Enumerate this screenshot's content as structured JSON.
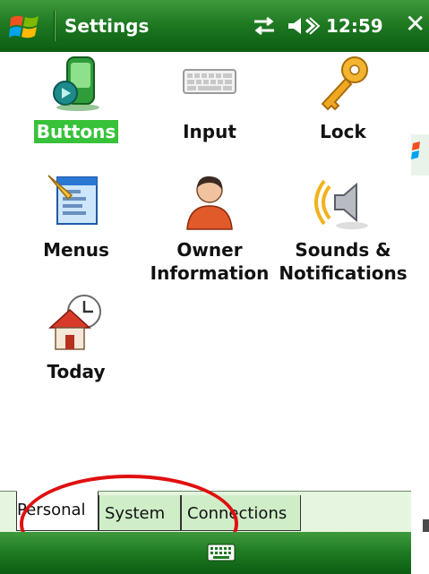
{
  "titlebar": {
    "title": "Settings",
    "clock": "12:59",
    "close": "✕",
    "icons": [
      "windows-start-icon",
      "connectivity-icon",
      "volume-icon"
    ]
  },
  "items": [
    {
      "label": "Buttons",
      "icon": "buttons-icon",
      "selected": true
    },
    {
      "label": "Input",
      "icon": "keyboard-icon",
      "selected": false
    },
    {
      "label": "Lock",
      "icon": "key-icon",
      "selected": false
    },
    {
      "label": "Menus",
      "icon": "menus-icon",
      "selected": false
    },
    {
      "label_line1": "Owner",
      "label_line2": "Information",
      "icon": "owner-icon",
      "selected": false
    },
    {
      "label_line1": "Sounds &",
      "label_line2": "Notifications",
      "icon": "sounds-icon",
      "selected": false
    },
    {
      "label": "Today",
      "icon": "today-icon",
      "selected": false
    }
  ],
  "tabs": [
    {
      "label": "Personal",
      "active": true
    },
    {
      "label": "System",
      "active": false
    },
    {
      "label": "Connections",
      "active": false
    }
  ],
  "bottombar": {
    "icon": "keyboard-toggle-icon"
  },
  "colors": {
    "titlebar_green": "#1f7a22",
    "selection_green": "#38c23a",
    "tab_bg": "#e6f5df",
    "annotation_red": "#e01010"
  }
}
